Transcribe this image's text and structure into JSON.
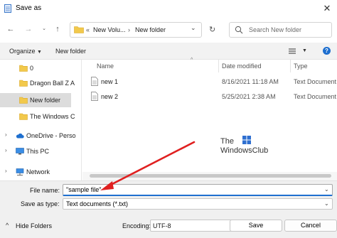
{
  "window": {
    "title": "Save as",
    "close_glyph": "✕"
  },
  "nav": {
    "back_glyph": "←",
    "forward_glyph": "→",
    "up_glyph": "↑",
    "address_breadcrumb_lead": "«",
    "address_segment_1": "New Volu...",
    "address_separator": "›",
    "address_segment_2": "New folder",
    "address_dropdown_glyph": "⌄",
    "refresh_glyph": "↻",
    "search_placeholder": "Search New folder"
  },
  "toolbar": {
    "organize_label": "Organize",
    "organize_caret": "▼",
    "new_folder_label": "New folder",
    "view_caret": "▼",
    "help_glyph": "?"
  },
  "sidebar": {
    "items": [
      {
        "label": "0"
      },
      {
        "label": "Dragon Ball Z A"
      },
      {
        "label": "New folder"
      },
      {
        "label": "The Windows C"
      },
      {
        "label": "OneDrive - Perso"
      },
      {
        "label": "This PC"
      },
      {
        "label": "Network"
      }
    ],
    "expander_glyph": "›"
  },
  "files": {
    "columns": [
      "Name",
      "Date modified",
      "Type"
    ],
    "rows": [
      {
        "name": "new 1",
        "date": "8/16/2021 11:18 AM",
        "type": "Text Document"
      },
      {
        "name": "new 2",
        "date": "5/25/2021 2:38 AM",
        "type": "Text Document"
      }
    ],
    "sort_glyph": "^"
  },
  "watermark": {
    "line1": "The",
    "line2": "WindowsClub"
  },
  "form": {
    "file_name_label": "File name:",
    "file_name_value": "\"sample file\"",
    "save_as_type_label": "Save as type:",
    "save_as_type_value": "Text documents (*.txt)",
    "encoding_label": "Encoding:",
    "encoding_value": "UTF-8",
    "dropdown_glyph": "⌄"
  },
  "buttons": {
    "hide_folders_label": "Hide Folders",
    "hide_folders_glyph": "^",
    "save_label": "Save",
    "cancel_label": "Cancel"
  },
  "colors": {
    "accent": "#1e6fcf",
    "folder": "#f2c94c",
    "annotation_arrow": "#e02020"
  }
}
